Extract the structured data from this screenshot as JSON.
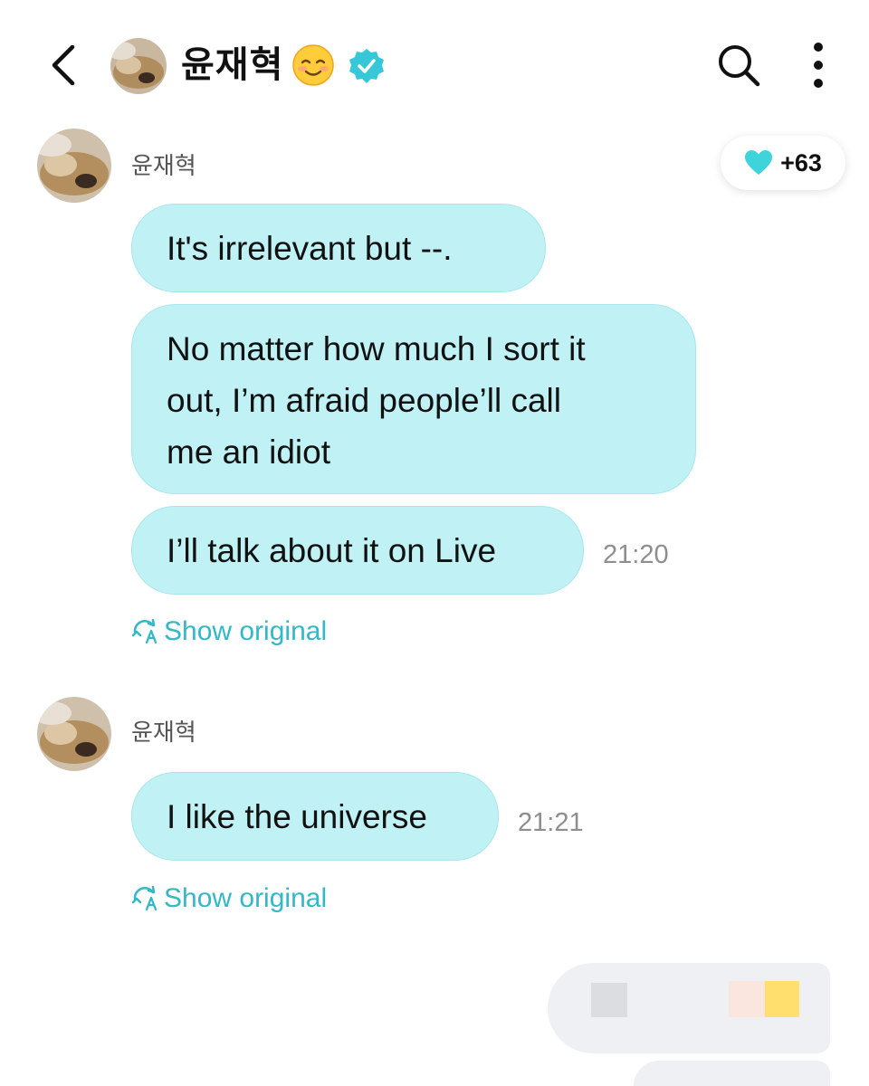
{
  "header": {
    "title": "윤재혁",
    "emoji": "smiling-face-icon",
    "verified_icon": "verified-badge-icon",
    "back_icon": "chevron-left-icon",
    "search_icon": "search-icon",
    "more_icon": "more-vertical-icon"
  },
  "like_badge": {
    "icon": "heart-icon",
    "count": "+63",
    "color": "#3fd3dc"
  },
  "colors": {
    "bubble": "#bff1f5",
    "accent": "#32b8c6",
    "verified": "#36c8d8"
  },
  "messages": [
    {
      "sender": "윤재혁",
      "bubbles": [
        {
          "lines": [
            "It's irrelevant but --."
          ]
        },
        {
          "lines": [
            "No matter how much I sort it",
            "out, I’m afraid people’ll call",
            "me an idiot"
          ]
        },
        {
          "lines": [
            "I’ll talk about it on Live"
          ]
        }
      ],
      "time": "21:20",
      "show_original": "Show original"
    },
    {
      "sender": "윤재혁",
      "bubbles": [
        {
          "lines": [
            "I like the universe"
          ]
        }
      ],
      "time": "21:21",
      "show_original": "Show original"
    }
  ]
}
